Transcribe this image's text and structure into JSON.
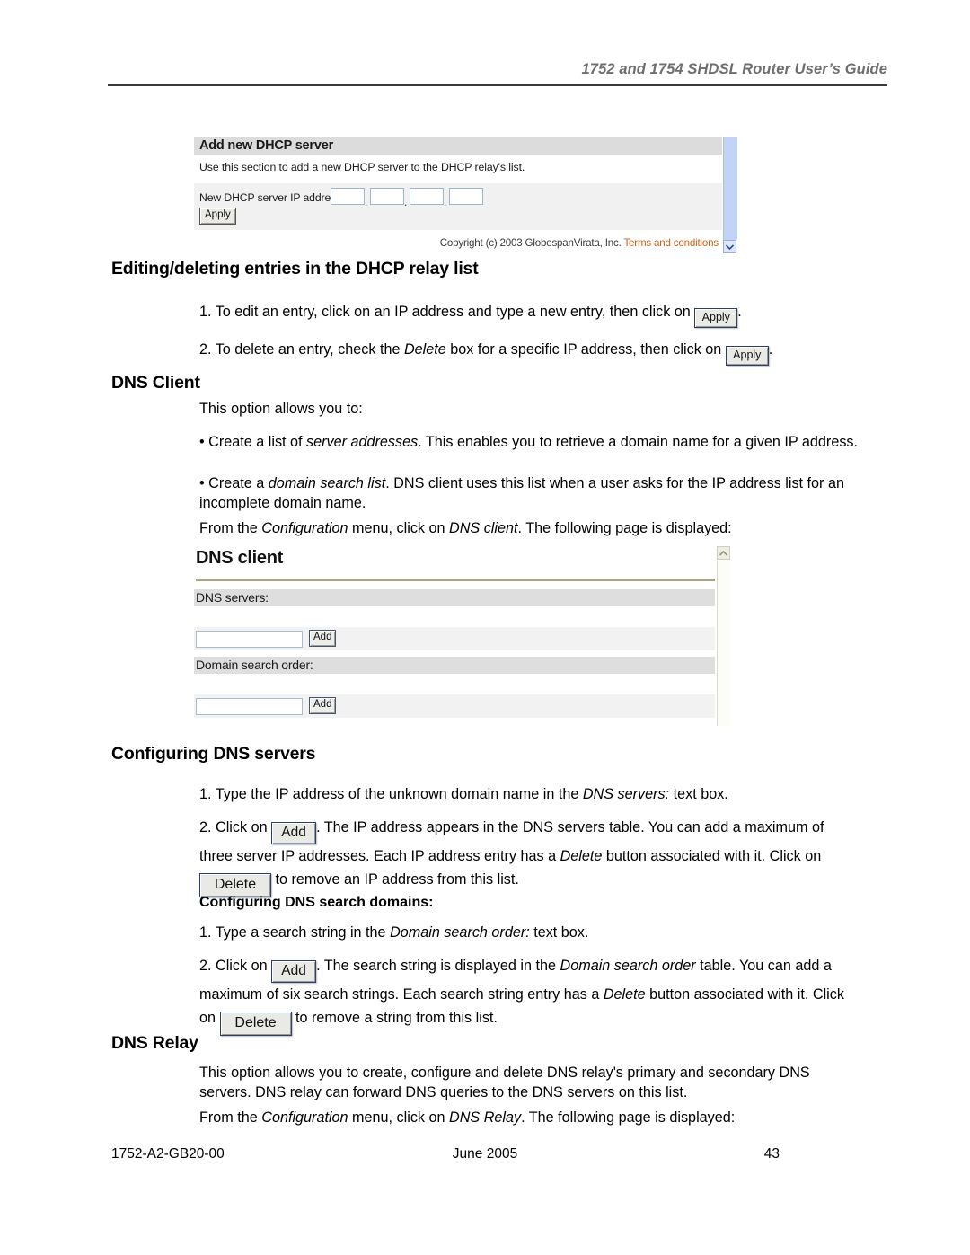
{
  "document": {
    "running_head": "1752 and 1754 SHDSL Router User’s Guide",
    "footer": {
      "part_number": "1752-A2-GB20-00",
      "date": "June 2005",
      "page_number": "43"
    }
  },
  "figure_dhcp": {
    "title": "Add new DHCP server",
    "description": "Use this section to add a new DHCP server to the DHCP relay's list.",
    "field_label": "New DHCP server IP address:",
    "octets": [
      "",
      "",
      "",
      ""
    ],
    "separator": ".",
    "apply_label": "Apply",
    "copyright": "Copyright (c) 2003 GlobespanVirata, Inc.",
    "terms_link": "Terms and conditions",
    "terms_link_color": "#d2601a",
    "scroll_down_icon": "chevron-down-icon"
  },
  "section_editing": {
    "heading": "Editing/deleting entries in the DHCP relay list",
    "step1": {
      "prefix": "1. To edit an entry, click on an IP address and type a new entry, then click on ",
      "button": "Apply",
      "suffix": "."
    },
    "step2": {
      "prefix": "2. To delete an entry, check the ",
      "italic1": "Delete",
      "mid": " box for a specific IP address, then click on ",
      "button": "Apply",
      "suffix": "."
    }
  },
  "section_dns_client": {
    "heading": "DNS Client",
    "intro": "This option allows you to:",
    "bullet1": {
      "prefix": "• Create a list of ",
      "italic": "server addresses",
      "suffix": ". This enables you to retrieve a domain name for a given IP address."
    },
    "bullet2": {
      "prefix": "• Create a ",
      "italic": "domain search list",
      "suffix": ". DNS client uses this list when a user asks for the IP address list for an incomplete domain name."
    },
    "from_menu": {
      "prefix": "From the ",
      "italic1": "Configuration",
      "mid": " menu, click on ",
      "italic2": "DNS client",
      "suffix": ". The following page is displayed:"
    }
  },
  "figure_dns_client": {
    "title": "DNS client",
    "section1_label": "DNS servers:",
    "section1_input_value": "",
    "section1_add_label": "Add",
    "section2_label": "Domain search order:",
    "section2_input_value": "",
    "section2_add_label": "Add",
    "scroll_up_icon": "chevron-up-icon"
  },
  "section_config_servers": {
    "heading": "Configuring DNS servers",
    "step1": {
      "prefix": "1. Type the IP address of the unknown domain name in the ",
      "italic": "DNS servers:",
      "suffix": " text box."
    },
    "step2": {
      "prefix": "2. Click on ",
      "add_button": "Add",
      "mid1": ". The IP address appears in the DNS servers table. You can add a maximum of three server IP addresses. Each IP address entry has a ",
      "italic": "Delete",
      "mid2": " button associated with it. Click on ",
      "delete_button": "Delete",
      "suffix": " to remove an IP address from this list."
    }
  },
  "section_config_search": {
    "heading": "Configuring DNS search domains:",
    "step1": {
      "prefix": "1. Type a search string in the ",
      "italic": "Domain search order:",
      "suffix": " text box."
    },
    "step2": {
      "prefix": "2. Click on ",
      "add_button": "Add",
      "mid1": ". The search string is displayed in the ",
      "italic1": "Domain search order",
      "mid2": " table. You can add a maximum of six search strings. Each search string entry has a ",
      "italic2": "Delete",
      "mid3": " button associated with it. Click on ",
      "delete_button": "Delete",
      "suffix": " to remove a string from this list."
    }
  },
  "section_dns_relay": {
    "heading": "DNS Relay",
    "para1": "This option allows you to create, configure and delete DNS relay's primary and secondary DNS servers. DNS relay can forward DNS queries to the DNS servers on this list.",
    "para2": {
      "prefix": "From the ",
      "italic1": "Configuration",
      "mid": " menu, click on ",
      "italic2": "DNS Relay",
      "suffix": ". The following page is displayed:"
    }
  }
}
